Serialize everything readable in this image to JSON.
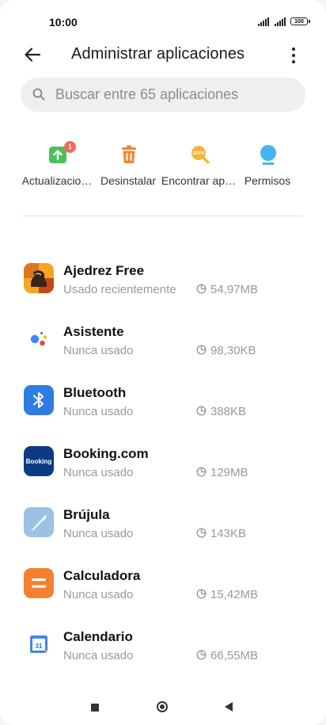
{
  "status_bar": {
    "time": "10:00",
    "battery": "100"
  },
  "header": {
    "title": "Administrar aplicaciones"
  },
  "search": {
    "placeholder": "Buscar entre 65 aplicaciones"
  },
  "quick_actions": [
    {
      "label": "Actualizacio…",
      "icon": "update-icon",
      "badge": "1",
      "color": "#4cc15a"
    },
    {
      "label": "Desinstalar",
      "icon": "trash-icon",
      "color": "#f5852a"
    },
    {
      "label": "Encontrar ap…",
      "icon": "find-apps-icon",
      "icon_text": "APPS",
      "color": "#f7b43a"
    },
    {
      "label": "Permisos",
      "icon": "permissions-icon",
      "color": "#45b4ee"
    }
  ],
  "apps": [
    {
      "name": "Ajedrez Free",
      "status": "Usado recientemente",
      "size": "54,97MB",
      "icon": "chess-app-icon"
    },
    {
      "name": "Asistente",
      "status": "Nunca usado",
      "size": "98,30KB",
      "icon": "assistant-app-icon"
    },
    {
      "name": "Bluetooth",
      "status": "Nunca usado",
      "size": "388KB",
      "icon": "bluetooth-app-icon"
    },
    {
      "name": "Booking.com",
      "status": "Nunca usado",
      "size": "129MB",
      "icon": "booking-app-icon",
      "icon_text": "Booking"
    },
    {
      "name": "Brújula",
      "status": "Nunca usado",
      "size": "143KB",
      "icon": "compass-app-icon"
    },
    {
      "name": "Calculadora",
      "status": "Nunca usado",
      "size": "15,42MB",
      "icon": "calculator-app-icon"
    },
    {
      "name": "Calendario",
      "status": "Nunca usado",
      "size": "66,55MB",
      "icon": "calendar-app-icon",
      "icon_text": "31"
    }
  ]
}
